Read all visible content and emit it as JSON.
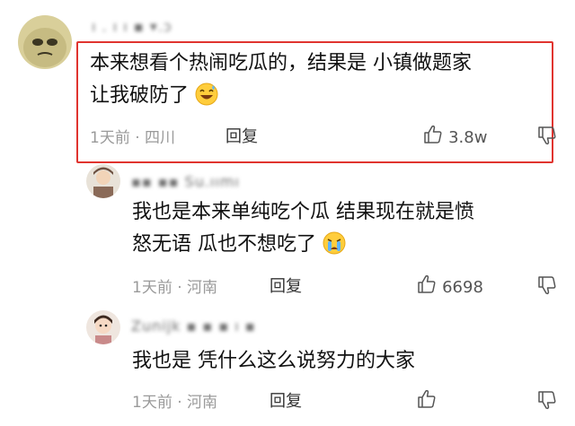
{
  "comments": [
    {
      "username": "ı   .  ı  ı ▪ ▾.ɔ",
      "text_line1": "本来想看个热闹吃瓜的，结果是 小镇做题家",
      "text_line2": "让我破防了",
      "emoji_icon": "sweat-smile-emoji",
      "meta": "1天前 · 四川",
      "reply_label": "回复",
      "like_count": "3.8w",
      "highlighted": true
    },
    {
      "username": "▪▪  ▪▪ Su.ıımı",
      "text_line1": "我也是本来单纯吃个瓜 结果现在就是愤",
      "text_line2": "怒无语 瓜也不想吃了",
      "emoji_icon": "crying-emoji",
      "meta": "1天前 · 河南",
      "reply_label": "回复",
      "like_count": "6698"
    },
    {
      "username": "Zunijk ▪ ▪  ▪ ı   ▪",
      "text_line1": "我也是 凭什么这么说努力的大家",
      "meta": "1天前 · 河南",
      "reply_label": "回复"
    }
  ],
  "colors": {
    "highlight": "#e0342f",
    "meta": "#9a9a9a"
  }
}
